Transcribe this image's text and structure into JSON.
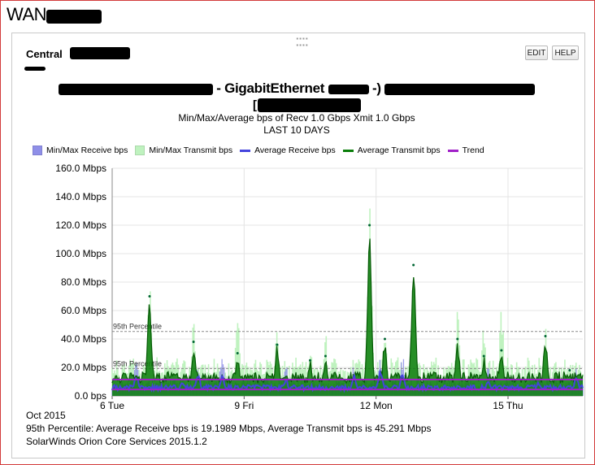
{
  "window": {
    "title": "WAN"
  },
  "panel": {
    "title": "Central",
    "edit_label": "EDIT",
    "help_label": "HELP",
    "heading_left": "-",
    "heading_mid": "- GigabitEthernet",
    "heading_right": "-)",
    "heading_bracket": "[",
    "subtitle1": "Min/Max/Average bps of    Recv 1.0 Gbps   Xmit 1.0 Gbps",
    "subtitle2": "LAST 10 DAYS"
  },
  "legend": [
    {
      "label": "Min/Max Receive bps",
      "color": "#8f8fe8",
      "kind": "box"
    },
    {
      "label": "Min/Max Transmit bps",
      "color": "#bff2bf",
      "kind": "box"
    },
    {
      "label": "Average Receive bps",
      "color": "#4444dd",
      "kind": "line"
    },
    {
      "label": "Average Transmit bps",
      "color": "#0a7d0a",
      "kind": "line"
    },
    {
      "label": "Trend",
      "color": "#a020c8",
      "kind": "line"
    }
  ],
  "footer": {
    "month": "Oct 2015",
    "percentile_text": "95th Percentile: Average Receive bps is 19.1989  Mbps, Average Transmit bps is 45.291  Mbps",
    "product": "SolarWinds Orion Core Services 2015.1.2"
  },
  "chart_data": {
    "type": "area",
    "xlabel": "",
    "ylabel": "",
    "x_ticks": [
      "6 Tue",
      "9 Fri",
      "12 Mon",
      "15 Thu"
    ],
    "x_range_days": [
      6,
      16.7
    ],
    "y_ticks": [
      "0.0 bps",
      "20.0 Mbps",
      "40.0 Mbps",
      "60.0 Mbps",
      "80.0 Mbps",
      "100.0 Mbps",
      "120.0 Mbps",
      "140.0 Mbps",
      "160.0 Mbps"
    ],
    "ylim": [
      0,
      160
    ],
    "percentile_lines": [
      {
        "label": "95th Percentile",
        "value": 45.291
      },
      {
        "label": "95th Percentile",
        "value": 19.1989
      }
    ],
    "trend": [
      {
        "name": "Average Transmit bps trend",
        "value": 11.5
      },
      {
        "name": "Average Receive bps trend",
        "value": 4.5
      }
    ],
    "baselines": {
      "receive_mbps": 4,
      "transmit_mbps": 9
    },
    "peaks_transmit": [
      {
        "day": 6.85,
        "avg": 70,
        "max": 78
      },
      {
        "day": 7.85,
        "avg": 38,
        "max": 56
      },
      {
        "day": 8.85,
        "avg": 30,
        "max": 62
      },
      {
        "day": 9.75,
        "avg": 36,
        "max": 45
      },
      {
        "day": 10.5,
        "avg": 25,
        "max": 35
      },
      {
        "day": 10.85,
        "avg": 28,
        "max": 45
      },
      {
        "day": 11.85,
        "avg": 120,
        "max": 141
      },
      {
        "day": 12.2,
        "avg": 40,
        "max": 55
      },
      {
        "day": 12.85,
        "avg": 92,
        "max": 100
      },
      {
        "day": 13.85,
        "avg": 40,
        "max": 64
      },
      {
        "day": 14.45,
        "avg": 28,
        "max": 50
      },
      {
        "day": 14.85,
        "avg": 32,
        "max": 66
      },
      {
        "day": 15.85,
        "avg": 42,
        "max": 50
      },
      {
        "day": 16.4,
        "avg": 18,
        "max": 26
      }
    ],
    "peaks_receive": [
      {
        "day": 6.55,
        "avg": 14,
        "max": 24
      },
      {
        "day": 7.6,
        "avg": 10,
        "max": 16
      },
      {
        "day": 7.95,
        "avg": 16,
        "max": 26
      },
      {
        "day": 8.5,
        "avg": 15,
        "max": 32
      },
      {
        "day": 9.95,
        "avg": 12,
        "max": 22
      },
      {
        "day": 11.5,
        "avg": 15,
        "max": 22
      },
      {
        "day": 12.1,
        "avg": 18,
        "max": 27
      },
      {
        "day": 12.6,
        "avg": 17,
        "max": 30
      },
      {
        "day": 14.55,
        "avg": 11,
        "max": 22
      },
      {
        "day": 15.7,
        "avg": 10,
        "max": 16
      },
      {
        "day": 16.55,
        "avg": 14,
        "max": 24
      }
    ]
  }
}
